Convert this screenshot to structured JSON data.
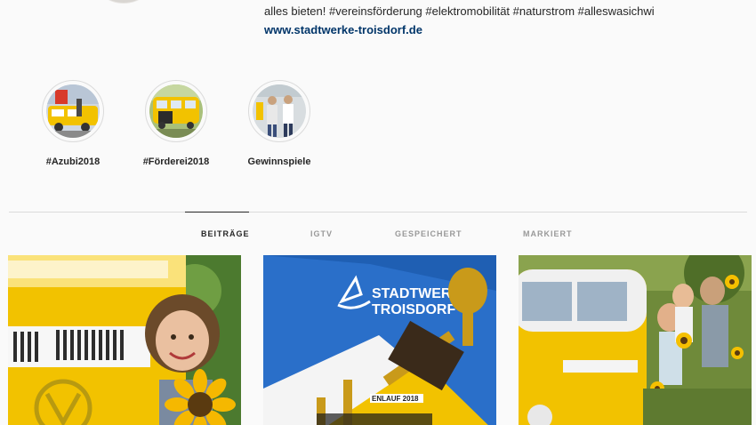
{
  "profile": {
    "bio_line": "alles bieten! #vereinsförderung #elektromobilität #naturstrom #alleswasichwi",
    "website": "www.stadtwerke-troisdorf.de"
  },
  "highlights": [
    {
      "label": "#Azubi2018"
    },
    {
      "label": "#Förderei2018"
    },
    {
      "label": "Gewinnspiele"
    }
  ],
  "tabs": [
    {
      "label": "BEITRÄGE",
      "active": true
    },
    {
      "label": "IGTV",
      "active": false
    },
    {
      "label": "GESPEICHERT",
      "active": false
    },
    {
      "label": "MARKIERT",
      "active": false
    }
  ],
  "posts": [
    {
      "icon": "bus-girl-sunflower-photo"
    },
    {
      "icon": "trophy-shirt-photo",
      "shirt_text_1": "STADTWERKE",
      "shirt_text_2": "TROISDORF",
      "ribbon_text": "ENLAUF 2018"
    },
    {
      "icon": "bus-family-field-photo"
    }
  ],
  "colors": {
    "bus_yellow": "#f2c200",
    "shirt_blue": "#2a6fc9",
    "link": "#003569",
    "grass": "#6f8a3a"
  }
}
